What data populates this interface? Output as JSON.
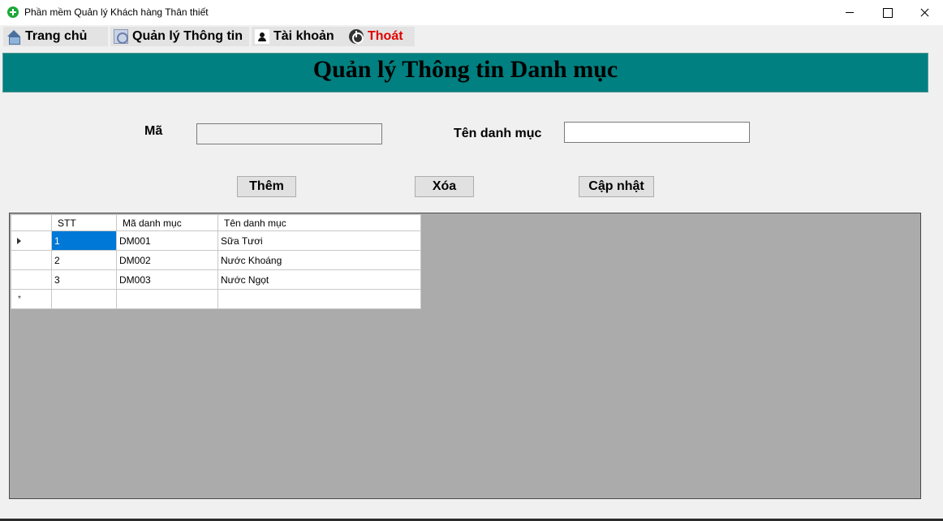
{
  "window": {
    "title": "Phần mềm Quản lý Khách hàng Thân thiết"
  },
  "menu": {
    "items": [
      {
        "label": "Trang chủ",
        "icon": "home-icon"
      },
      {
        "label": "Quản lý Thông tin",
        "icon": "info-icon"
      },
      {
        "label": "Tài khoản",
        "icon": "account-icon"
      },
      {
        "label": "Thoát",
        "icon": "power-icon",
        "color": "#e00000"
      }
    ]
  },
  "header": {
    "title": "Quản lý Thông tin Danh mục",
    "background": "#008080"
  },
  "form": {
    "ma_label": "Mã",
    "ma_value": "",
    "ten_label": "Tên danh mục",
    "ten_value": ""
  },
  "buttons": {
    "add": "Thêm",
    "delete": "Xóa",
    "update": "Cập nhật"
  },
  "grid": {
    "columns": [
      "STT",
      "Mã danh mục",
      "Tên danh mục"
    ],
    "rows": [
      {
        "stt": "1",
        "ma": "DM001",
        "ten": "Sữa Tươi"
      },
      {
        "stt": "2",
        "ma": "DM002",
        "ten": "Nước Khoáng"
      },
      {
        "stt": "3",
        "ma": "DM003",
        "ten": "Nước Ngọt"
      }
    ],
    "new_row_marker": "*",
    "selection_color": "#0078d7"
  }
}
